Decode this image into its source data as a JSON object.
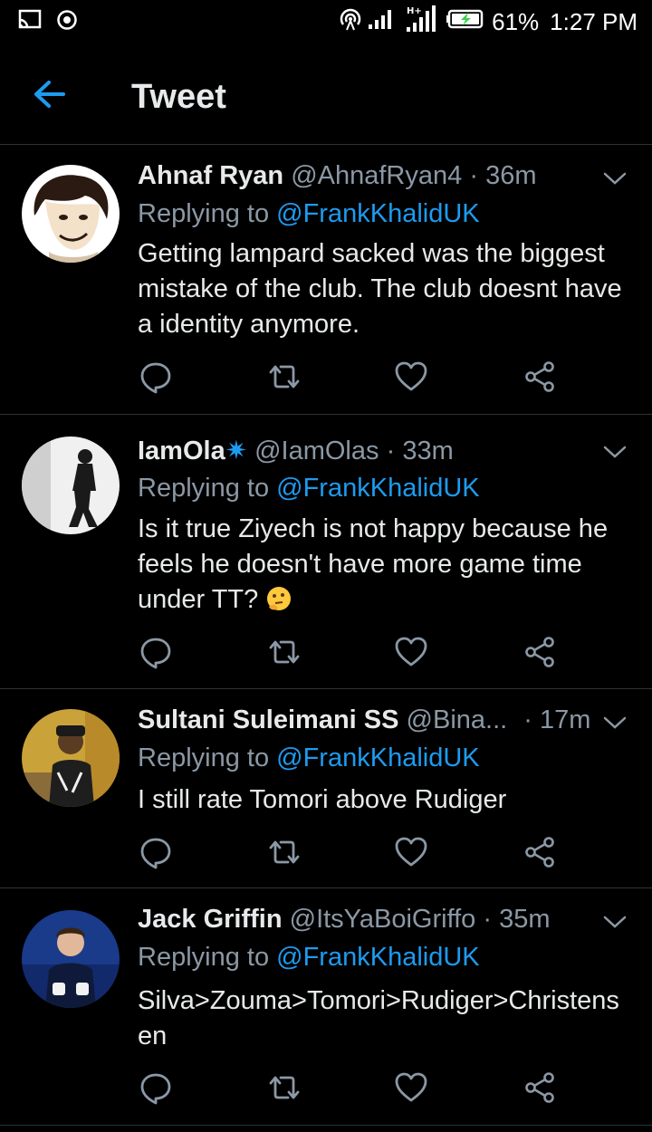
{
  "status_bar": {
    "battery": "61%",
    "time": "1:27 PM"
  },
  "header": {
    "title": "Tweet",
    "back_icon": "arrow-left-icon"
  },
  "tweets": [
    {
      "name": "Ahnaf Ryan",
      "handle": "@AhnafRyan4",
      "time": "36m",
      "replying_prefix": "Replying to ",
      "replying_to": "@FrankKhalidUK",
      "text": "Getting lampard sacked was the biggest mistake of the club. The club doesnt have a identity anymore."
    },
    {
      "name": "IamOla",
      "name_badge": "✷",
      "handle": "@IamOlas",
      "time": "33m",
      "replying_prefix": "Replying to ",
      "replying_to": "@FrankKhalidUK",
      "text": "Is it true Ziyech is not happy because he feels he doesn't have more game time under TT?"
    },
    {
      "name": "Sultani Suleimani SS",
      "handle": "@Bina...",
      "time": "17m",
      "replying_prefix": "Replying to ",
      "replying_to": "@FrankKhalidUK",
      "text": "I still rate Tomori above Rudiger"
    },
    {
      "name": "Jack Griffin",
      "handle": "@ItsYaBoiGriffo",
      "time": "35m",
      "replying_prefix": "Replying to ",
      "replying_to": "@FrankKhalidUK",
      "text": "Silva>Zouma>Tomori>Rudiger>Christensen"
    }
  ],
  "colors": {
    "background": "#000000",
    "accent": "#1d9bf0",
    "secondary_text": "#8b98a5",
    "divider": "#2f3336"
  }
}
